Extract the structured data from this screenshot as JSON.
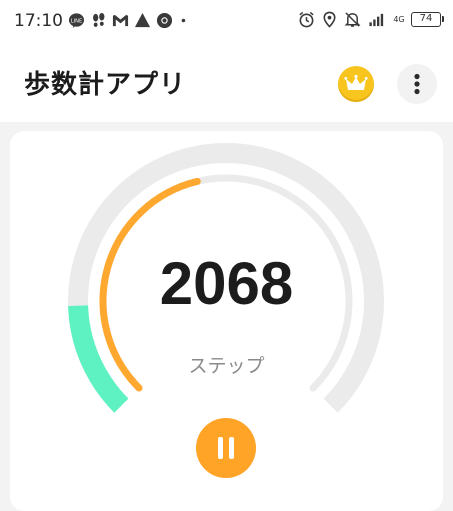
{
  "status_bar": {
    "time": "17:10",
    "network_type": "4G",
    "battery_level": "74",
    "left_icons": [
      "line-icon",
      "footprints-icon",
      "gmail-icon",
      "triangle-icon",
      "chrome-icon",
      "dot-icon"
    ],
    "right_icons": [
      "alarm-icon",
      "location-icon",
      "bell-off-icon",
      "signal-icon",
      "battery-icon"
    ]
  },
  "app_bar": {
    "title": "歩数計アプリ",
    "premium_icon": "crown-icon",
    "more_icon": "more-vert-icon"
  },
  "step_card": {
    "step_count": "2068",
    "step_label": "ステップ",
    "pause_icon": "pause-icon",
    "outer_ring_progress": 0.16,
    "inner_ring_progress": 0.45,
    "colors": {
      "outer_progress": "#5ef2c3",
      "inner_progress": "#ffa830",
      "track": "#ebebeb",
      "pause_button": "#ffa426"
    }
  }
}
